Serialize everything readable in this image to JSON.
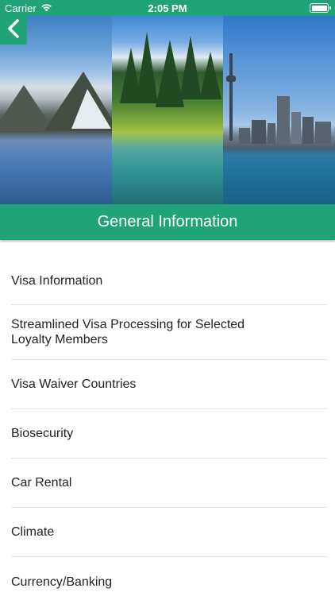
{
  "status_bar": {
    "carrier": "Carrier",
    "time": "2:05 PM",
    "wifi_icon": "wifi-icon",
    "battery_icon": "battery-icon",
    "battery_level": 1.0
  },
  "nav": {
    "back_icon": "chevron-left-icon"
  },
  "header": {
    "title": "General Information"
  },
  "list": {
    "items": [
      {
        "label": "Visa Information"
      },
      {
        "label": "Streamlined Visa Processing for Selected Loyalty Members"
      },
      {
        "label": "Visa Waiver Countries"
      },
      {
        "label": "Biosecurity"
      },
      {
        "label": "Car Rental"
      },
      {
        "label": "Climate"
      },
      {
        "label": "Currency/Banking"
      }
    ]
  },
  "colors": {
    "accent": "#20a377",
    "divider": "#e2e2e2",
    "text": "#222222"
  }
}
